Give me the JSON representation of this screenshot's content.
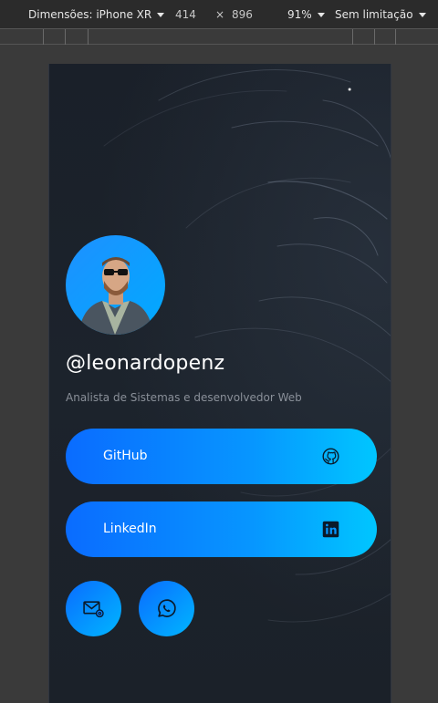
{
  "devtools": {
    "device_label": "Dimensões: iPhone XR",
    "width_value": "414",
    "times_symbol": "×",
    "height_value": "896",
    "zoom": "91%",
    "throttle": "Sem limitação"
  },
  "profile": {
    "handle": "@leonardopenz",
    "subtitle": "Analista de Sistemas e desenvolvedor Web"
  },
  "links": [
    {
      "label": "GitHub",
      "icon": "github-icon"
    },
    {
      "label": "LinkedIn",
      "icon": "linkedin-icon"
    }
  ],
  "social_buttons": [
    {
      "icon": "email-icon"
    },
    {
      "icon": "whatsapp-icon"
    }
  ],
  "colors": {
    "accent_start": "#0a6cff",
    "accent_end": "#00c6ff",
    "background": "#1b2129"
  }
}
